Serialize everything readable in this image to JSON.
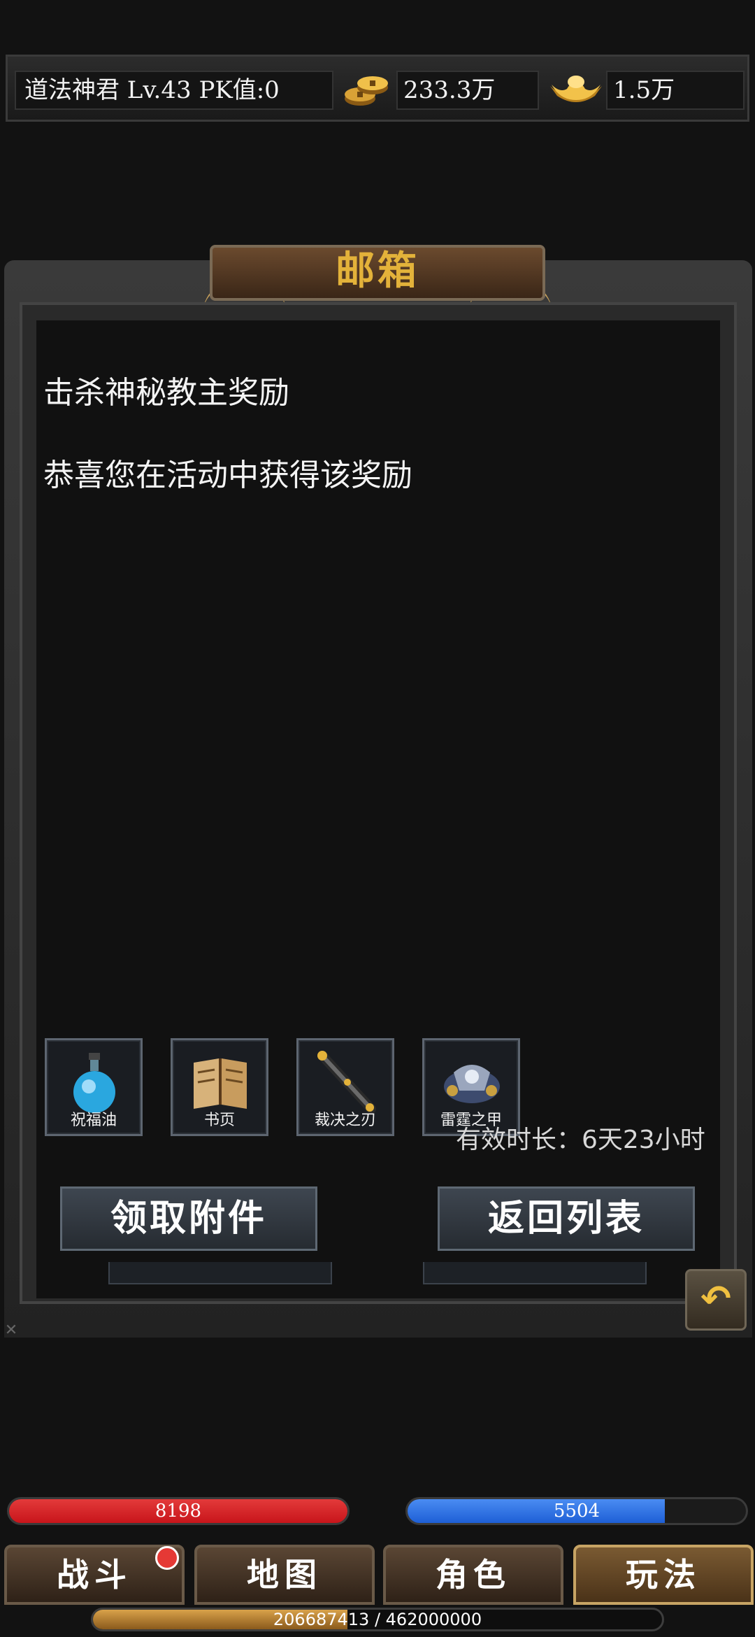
{
  "status": {
    "player_info": "道法神君  Lv.43 PK值:0",
    "gold": "233.3万",
    "ingot": "1.5万",
    "gold_icon": "coin-stack-icon",
    "ingot_icon": "gold-ingot-icon"
  },
  "mail": {
    "window_title": "邮箱",
    "subject": "击杀神秘教主奖励",
    "body": "恭喜您在活动中获得该奖励",
    "attachments": [
      {
        "name": "祝福油",
        "icon": "potion-bottle-icon"
      },
      {
        "name": "书页",
        "icon": "book-page-icon"
      },
      {
        "name": "裁决之刃",
        "icon": "blade-icon"
      },
      {
        "name": "雷霆之甲",
        "icon": "armor-icon"
      }
    ],
    "validity": "有效时长：6天23小时",
    "claim_label": "领取附件",
    "back_label": "返回列表"
  },
  "bars": {
    "hp_value": "8198",
    "hp_fraction": 1.0,
    "mp_value": "5504",
    "mp_fraction": 0.76,
    "hp_color": "#c8151b",
    "mp_color": "#1e5fd6"
  },
  "nav": {
    "tabs": [
      "战斗",
      "地图",
      "角色",
      "玩法"
    ],
    "active_index": 3
  },
  "exp": {
    "text": "206687413 / 462000000",
    "fraction": 0.447
  }
}
